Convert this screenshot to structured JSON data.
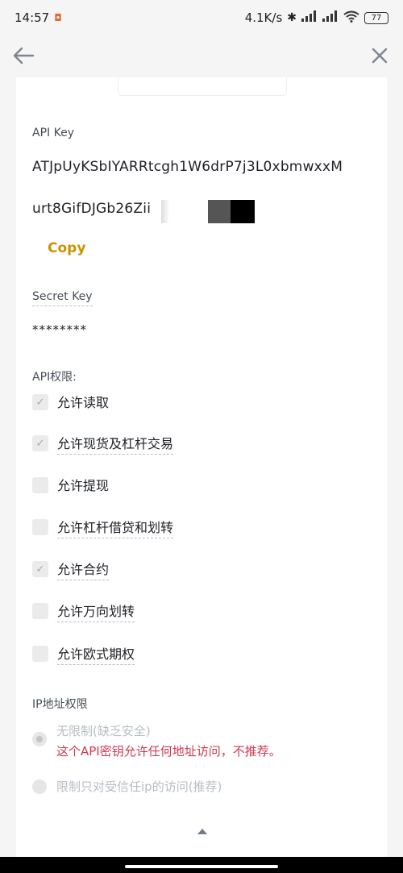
{
  "status_bar": {
    "time": "14:57",
    "network_speed": "4.1K/s",
    "battery": "77",
    "icons": [
      "notification-icon",
      "bluetooth-icon",
      "signal-icon",
      "hd-signal-icon",
      "wifi-icon",
      "battery-icon"
    ]
  },
  "nav": {
    "back_icon": "back-arrow-icon",
    "close_icon": "close-icon"
  },
  "api_key": {
    "label": "API Key",
    "line1": "ATJpUyKSbIYARRtcgh1W6drP7j3L0xbmwxxM",
    "line2": "urt8GifDJGb26Zii",
    "copy_label": "Copy"
  },
  "secret_key": {
    "label": "Secret Key",
    "value": "********"
  },
  "permissions": {
    "title": "API权限:",
    "items": [
      {
        "label": "允许读取",
        "checked": true
      },
      {
        "label": "允许现货及杠杆交易",
        "checked": true
      },
      {
        "label": "允许提现",
        "checked": false
      },
      {
        "label": "允许杠杆借贷和划转",
        "checked": false
      },
      {
        "label": "允许合约",
        "checked": true
      },
      {
        "label": "允许万向划转",
        "checked": false
      },
      {
        "label": "允许欧式期权",
        "checked": false
      }
    ]
  },
  "ip_restriction": {
    "title": "IP地址权限",
    "options": [
      {
        "label": "无限制(缺乏安全)",
        "warning": "这个API密钥允许任何地址访问，不推荐。",
        "selected": true
      },
      {
        "label": "限制只对受信任ip的访问(推荐)",
        "selected": false
      }
    ]
  },
  "colors": {
    "accent": "#c99400",
    "warning": "#d0384e",
    "text": "#1e2026",
    "muted": "#b7bdc6"
  }
}
